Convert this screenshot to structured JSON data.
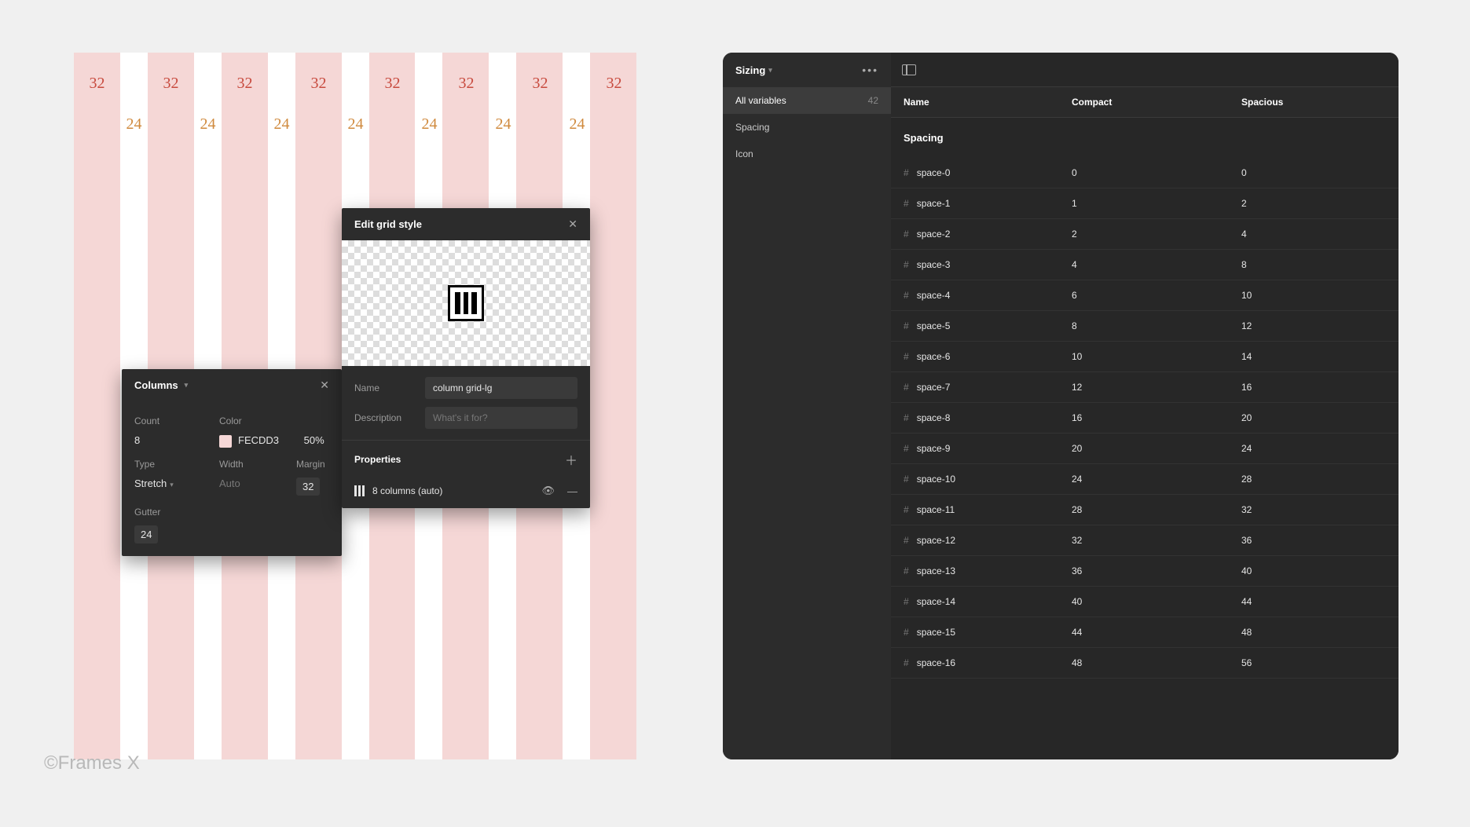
{
  "watermark": "©Frames X",
  "grid": {
    "column_label": "32",
    "gutter_label": "24",
    "columns": 8
  },
  "columns_panel": {
    "title": "Columns",
    "count_label": "Count",
    "count_value": "8",
    "color_label": "Color",
    "color_hex": "FECDD3",
    "color_opacity": "50%",
    "type_label": "Type",
    "type_value": "Stretch",
    "width_label": "Width",
    "width_value": "Auto",
    "margin_label": "Margin",
    "margin_value": "32",
    "gutter_label": "Gutter",
    "gutter_value": "24"
  },
  "edit_panel": {
    "title": "Edit grid style",
    "name_label": "Name",
    "name_value": "column grid-lg",
    "desc_label": "Description",
    "desc_placeholder": "What's it for?",
    "props_title": "Properties",
    "prop_text": "8 columns (auto)"
  },
  "variables": {
    "collection": "Sizing",
    "sidebar": {
      "all_label": "All variables",
      "all_count": "42",
      "groups": [
        "Spacing",
        "Icon"
      ]
    },
    "headers": {
      "name": "Name",
      "compact": "Compact",
      "spacious": "Spacious"
    },
    "group_title": "Spacing",
    "rows": [
      {
        "name": "space-0",
        "compact": "0",
        "spacious": "0"
      },
      {
        "name": "space-1",
        "compact": "1",
        "spacious": "2"
      },
      {
        "name": "space-2",
        "compact": "2",
        "spacious": "4"
      },
      {
        "name": "space-3",
        "compact": "4",
        "spacious": "8"
      },
      {
        "name": "space-4",
        "compact": "6",
        "spacious": "10"
      },
      {
        "name": "space-5",
        "compact": "8",
        "spacious": "12"
      },
      {
        "name": "space-6",
        "compact": "10",
        "spacious": "14"
      },
      {
        "name": "space-7",
        "compact": "12",
        "spacious": "16"
      },
      {
        "name": "space-8",
        "compact": "16",
        "spacious": "20"
      },
      {
        "name": "space-9",
        "compact": "20",
        "spacious": "24"
      },
      {
        "name": "space-10",
        "compact": "24",
        "spacious": "28"
      },
      {
        "name": "space-11",
        "compact": "28",
        "spacious": "32"
      },
      {
        "name": "space-12",
        "compact": "32",
        "spacious": "36"
      },
      {
        "name": "space-13",
        "compact": "36",
        "spacious": "40"
      },
      {
        "name": "space-14",
        "compact": "40",
        "spacious": "44"
      },
      {
        "name": "space-15",
        "compact": "44",
        "spacious": "48"
      },
      {
        "name": "space-16",
        "compact": "48",
        "spacious": "56"
      }
    ]
  }
}
